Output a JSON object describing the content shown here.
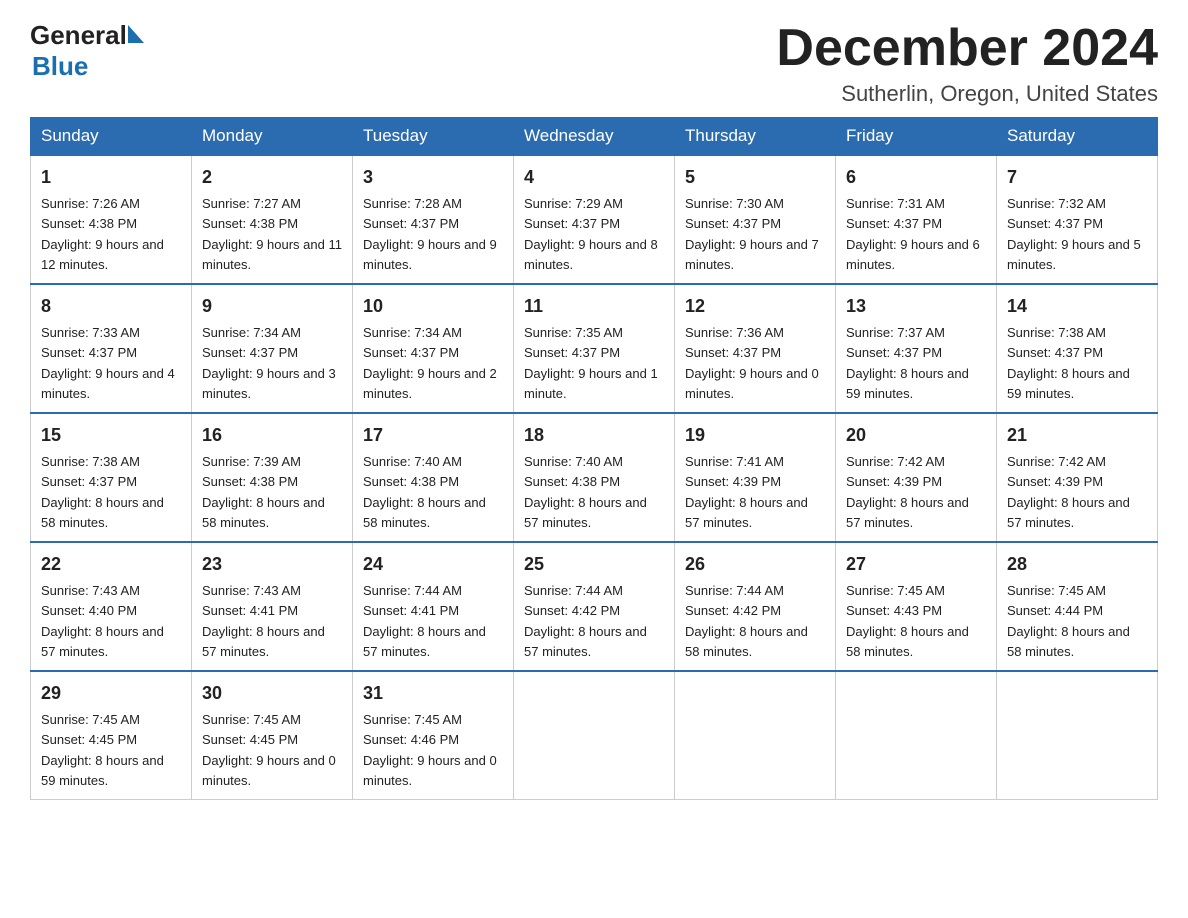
{
  "header": {
    "logo_general": "General",
    "logo_blue": "Blue",
    "month_year": "December 2024",
    "location": "Sutherlin, Oregon, United States"
  },
  "weekdays": [
    "Sunday",
    "Monday",
    "Tuesday",
    "Wednesday",
    "Thursday",
    "Friday",
    "Saturday"
  ],
  "weeks": [
    [
      {
        "day": "1",
        "sunrise": "7:26 AM",
        "sunset": "4:38 PM",
        "daylight": "9 hours and 12 minutes."
      },
      {
        "day": "2",
        "sunrise": "7:27 AM",
        "sunset": "4:38 PM",
        "daylight": "9 hours and 11 minutes."
      },
      {
        "day": "3",
        "sunrise": "7:28 AM",
        "sunset": "4:37 PM",
        "daylight": "9 hours and 9 minutes."
      },
      {
        "day": "4",
        "sunrise": "7:29 AM",
        "sunset": "4:37 PM",
        "daylight": "9 hours and 8 minutes."
      },
      {
        "day": "5",
        "sunrise": "7:30 AM",
        "sunset": "4:37 PM",
        "daylight": "9 hours and 7 minutes."
      },
      {
        "day": "6",
        "sunrise": "7:31 AM",
        "sunset": "4:37 PM",
        "daylight": "9 hours and 6 minutes."
      },
      {
        "day": "7",
        "sunrise": "7:32 AM",
        "sunset": "4:37 PM",
        "daylight": "9 hours and 5 minutes."
      }
    ],
    [
      {
        "day": "8",
        "sunrise": "7:33 AM",
        "sunset": "4:37 PM",
        "daylight": "9 hours and 4 minutes."
      },
      {
        "day": "9",
        "sunrise": "7:34 AM",
        "sunset": "4:37 PM",
        "daylight": "9 hours and 3 minutes."
      },
      {
        "day": "10",
        "sunrise": "7:34 AM",
        "sunset": "4:37 PM",
        "daylight": "9 hours and 2 minutes."
      },
      {
        "day": "11",
        "sunrise": "7:35 AM",
        "sunset": "4:37 PM",
        "daylight": "9 hours and 1 minute."
      },
      {
        "day": "12",
        "sunrise": "7:36 AM",
        "sunset": "4:37 PM",
        "daylight": "9 hours and 0 minutes."
      },
      {
        "day": "13",
        "sunrise": "7:37 AM",
        "sunset": "4:37 PM",
        "daylight": "8 hours and 59 minutes."
      },
      {
        "day": "14",
        "sunrise": "7:38 AM",
        "sunset": "4:37 PM",
        "daylight": "8 hours and 59 minutes."
      }
    ],
    [
      {
        "day": "15",
        "sunrise": "7:38 AM",
        "sunset": "4:37 PM",
        "daylight": "8 hours and 58 minutes."
      },
      {
        "day": "16",
        "sunrise": "7:39 AM",
        "sunset": "4:38 PM",
        "daylight": "8 hours and 58 minutes."
      },
      {
        "day": "17",
        "sunrise": "7:40 AM",
        "sunset": "4:38 PM",
        "daylight": "8 hours and 58 minutes."
      },
      {
        "day": "18",
        "sunrise": "7:40 AM",
        "sunset": "4:38 PM",
        "daylight": "8 hours and 57 minutes."
      },
      {
        "day": "19",
        "sunrise": "7:41 AM",
        "sunset": "4:39 PM",
        "daylight": "8 hours and 57 minutes."
      },
      {
        "day": "20",
        "sunrise": "7:42 AM",
        "sunset": "4:39 PM",
        "daylight": "8 hours and 57 minutes."
      },
      {
        "day": "21",
        "sunrise": "7:42 AM",
        "sunset": "4:39 PM",
        "daylight": "8 hours and 57 minutes."
      }
    ],
    [
      {
        "day": "22",
        "sunrise": "7:43 AM",
        "sunset": "4:40 PM",
        "daylight": "8 hours and 57 minutes."
      },
      {
        "day": "23",
        "sunrise": "7:43 AM",
        "sunset": "4:41 PM",
        "daylight": "8 hours and 57 minutes."
      },
      {
        "day": "24",
        "sunrise": "7:44 AM",
        "sunset": "4:41 PM",
        "daylight": "8 hours and 57 minutes."
      },
      {
        "day": "25",
        "sunrise": "7:44 AM",
        "sunset": "4:42 PM",
        "daylight": "8 hours and 57 minutes."
      },
      {
        "day": "26",
        "sunrise": "7:44 AM",
        "sunset": "4:42 PM",
        "daylight": "8 hours and 58 minutes."
      },
      {
        "day": "27",
        "sunrise": "7:45 AM",
        "sunset": "4:43 PM",
        "daylight": "8 hours and 58 minutes."
      },
      {
        "day": "28",
        "sunrise": "7:45 AM",
        "sunset": "4:44 PM",
        "daylight": "8 hours and 58 minutes."
      }
    ],
    [
      {
        "day": "29",
        "sunrise": "7:45 AM",
        "sunset": "4:45 PM",
        "daylight": "8 hours and 59 minutes."
      },
      {
        "day": "30",
        "sunrise": "7:45 AM",
        "sunset": "4:45 PM",
        "daylight": "9 hours and 0 minutes."
      },
      {
        "day": "31",
        "sunrise": "7:45 AM",
        "sunset": "4:46 PM",
        "daylight": "9 hours and 0 minutes."
      },
      null,
      null,
      null,
      null
    ]
  ]
}
